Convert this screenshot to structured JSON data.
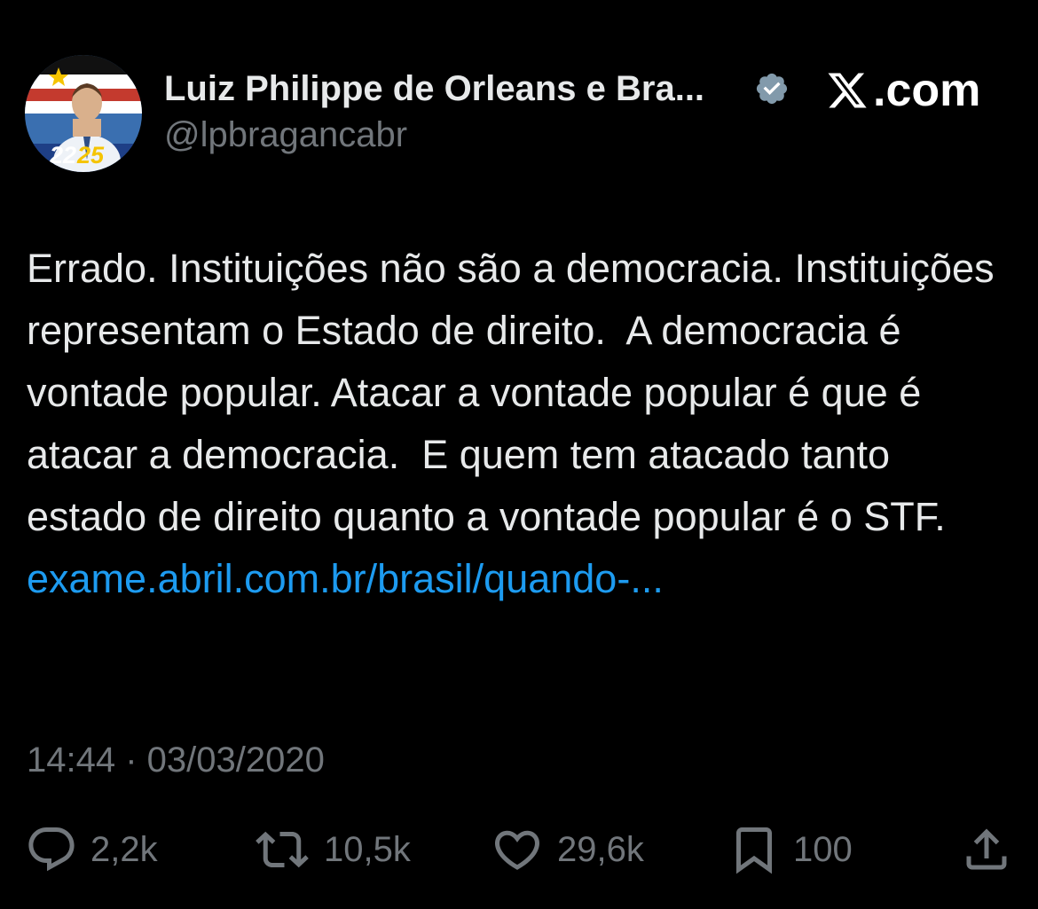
{
  "header": {
    "display_name": "Luiz Philippe de Orleans e Bra...",
    "handle": "@lpbragancabr",
    "avatar_badge_left": "22",
    "avatar_badge_right": "25",
    "brand_domain": ".com"
  },
  "tweet": {
    "text": "Errado. Instituições não são a democracia. Instituições representam o Estado de direito.  A democracia é vontade popular. Atacar a vontade popular é que é atacar a democracia.  E quem tem atacado tanto estado de direito quanto a vontade popular é o STF. ",
    "link": "exame.abril.com.br/brasil/quando-..."
  },
  "meta": {
    "timestamp": "14:44 · 03/03/2020"
  },
  "actions": {
    "replies": "2,2k",
    "reposts": "10,5k",
    "likes": "29,6k",
    "bookmarks": "100"
  },
  "colors": {
    "background": "#000000",
    "text": "#e7e9ea",
    "secondary": "#71767b",
    "link": "#1d9bf0",
    "verified": "#829aab",
    "badge_yellow": "#f5c400"
  },
  "icons": {
    "verified": "verified-badge-icon",
    "brand": "x-logo-icon",
    "reply": "reply-icon",
    "repost": "repost-icon",
    "like": "heart-icon",
    "bookmark": "bookmark-icon",
    "share": "share-icon"
  }
}
